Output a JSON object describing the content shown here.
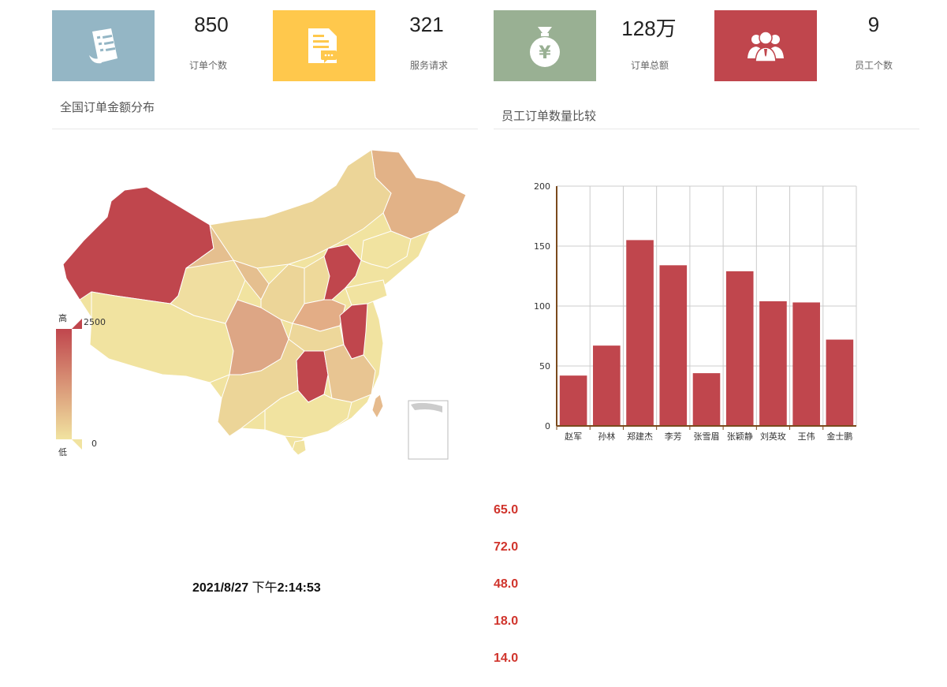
{
  "stats": [
    {
      "value": "850",
      "label": "订单个数",
      "icon": "document-list-icon",
      "color": "#94b6c5"
    },
    {
      "value": "321",
      "label": "服务请求",
      "icon": "chat-document-icon",
      "color": "#ffc84c"
    },
    {
      "value": "128万",
      "label": "订单总额",
      "icon": "money-bag-icon",
      "color": "#99b093"
    },
    {
      "value": "9",
      "label": "员工个数",
      "icon": "people-group-icon",
      "color": "#c0464d"
    }
  ],
  "map_panel": {
    "title": "全国订单金额分布",
    "legend": {
      "high_label": "高",
      "low_label": "低",
      "max": "2500",
      "min": "0"
    },
    "colors": {
      "high": "#c0464d",
      "low": "#f1e3a0"
    }
  },
  "chart_panel": {
    "title": "员工订单数量比较"
  },
  "chart_data": {
    "type": "bar",
    "categories": [
      "赵军",
      "孙林",
      "郑建杰",
      "李芳",
      "张雪眉",
      "张颖静",
      "刘英玫",
      "王伟",
      "金士鹏"
    ],
    "values": [
      42,
      67,
      155,
      134,
      44,
      129,
      104,
      103,
      72
    ],
    "ylim": [
      0,
      200
    ],
    "yticks": [
      "0",
      "50",
      "100",
      "150",
      "200"
    ],
    "bar_color": "#c0464d",
    "grid": true
  },
  "datetime": {
    "date": "2021/8/27",
    "ampm": "下午",
    "time": "2:14:53"
  },
  "value_list": [
    "65.0",
    "72.0",
    "48.0",
    "18.0",
    "14.0"
  ]
}
